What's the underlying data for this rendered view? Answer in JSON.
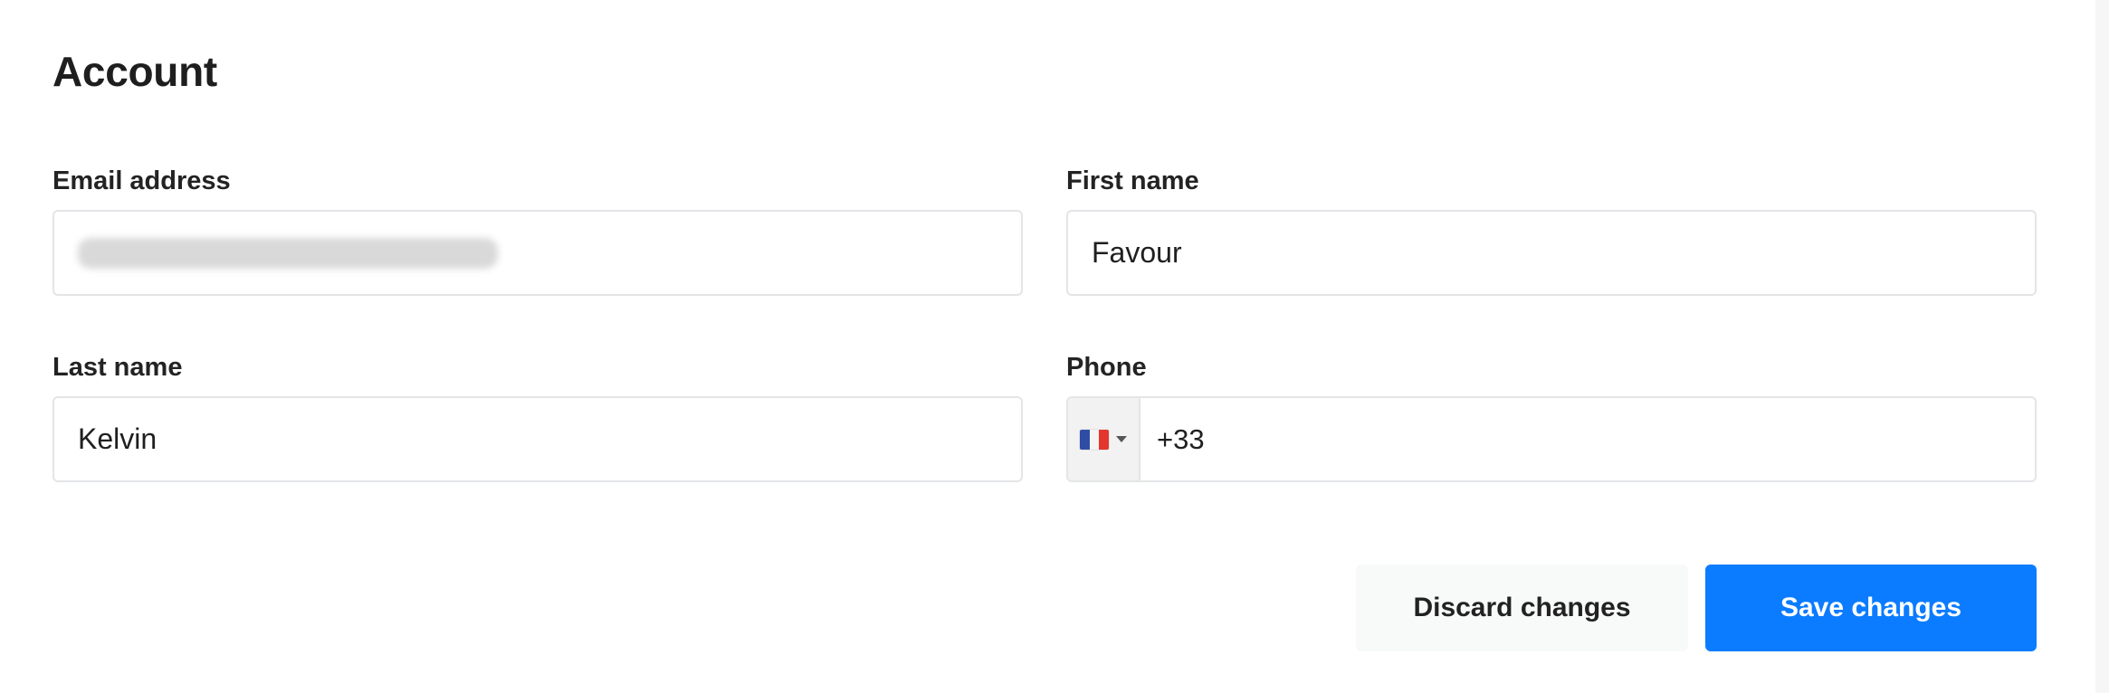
{
  "page": {
    "title": "Account"
  },
  "form": {
    "email": {
      "label": "Email address",
      "value": ""
    },
    "first_name": {
      "label": "First name",
      "value": "Favour"
    },
    "last_name": {
      "label": "Last name",
      "value": "Kelvin"
    },
    "phone": {
      "label": "Phone",
      "country_flag_icon": "france-flag-icon",
      "value": "+33"
    }
  },
  "actions": {
    "discard_label": "Discard changes",
    "save_label": "Save changes"
  },
  "colors": {
    "primary": "#0b7cff",
    "secondary_button_bg": "#f8f9f9",
    "input_border": "#e4e5e7",
    "flag_blue": "#2f4ea3",
    "flag_white": "#f4f4f4",
    "flag_red": "#e2362f"
  }
}
